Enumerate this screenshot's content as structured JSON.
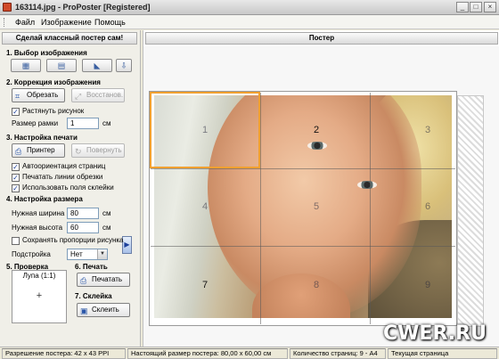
{
  "window": {
    "title": "163114.jpg - ProPoster [Registered]"
  },
  "menu": [
    "Файл",
    "Изображение",
    "Помощь"
  ],
  "left_panel": {
    "header": "Сделай классный постер сам!",
    "sections": {
      "select_image": "1. Выбор изображения",
      "image_correction": "2. Коррекция изображения",
      "print_setup": "3. Настройка печати",
      "size_setup": "4. Настройка размера",
      "preview": "5. Проверка",
      "print": "6. Печать",
      "glue": "7. Склейка"
    },
    "buttons": {
      "crop": "Обрезать",
      "restore": "Восстанов.",
      "printer": "Принтер",
      "rotate": "Повернуть",
      "print": "Печатать",
      "glue": "Склеить"
    },
    "checkboxes": {
      "stretch": "Растянуть рисунок",
      "auto_orient": "Автоориентация страниц",
      "cut_lines": "Печатать линии обрезки",
      "glue_margins": "Использовать поля склейки",
      "keep_ratio": "Сохранять пропорции рисунка"
    },
    "frame_size": {
      "label": "Размер рамки",
      "value": "1",
      "unit": "см"
    },
    "width": {
      "label": "Нужная ширина",
      "value": "80",
      "unit": "см"
    },
    "height": {
      "label": "Нужная высота",
      "value": "60",
      "unit": "см"
    },
    "fit": {
      "label": "Подстройка",
      "value": "Нет"
    },
    "magnifier": {
      "caption": "Лупа (1:1)",
      "symbol": "+"
    }
  },
  "right_panel": {
    "header": "Постер",
    "tiles": [
      "1",
      "2",
      "3",
      "4",
      "5",
      "6",
      "7",
      "8",
      "9"
    ]
  },
  "status": {
    "resolution": "Разрешение постера: 42 x 43 PPI",
    "real_size": "Настоящий размер постера: 80,00 x 60,00 см",
    "pages": "Количество страниц: 9 - A4",
    "extra": "Текущая страница"
  },
  "watermark": "CWER.RU",
  "colors": {
    "selection": "#f0a030",
    "field_border": "#7f9db9"
  }
}
